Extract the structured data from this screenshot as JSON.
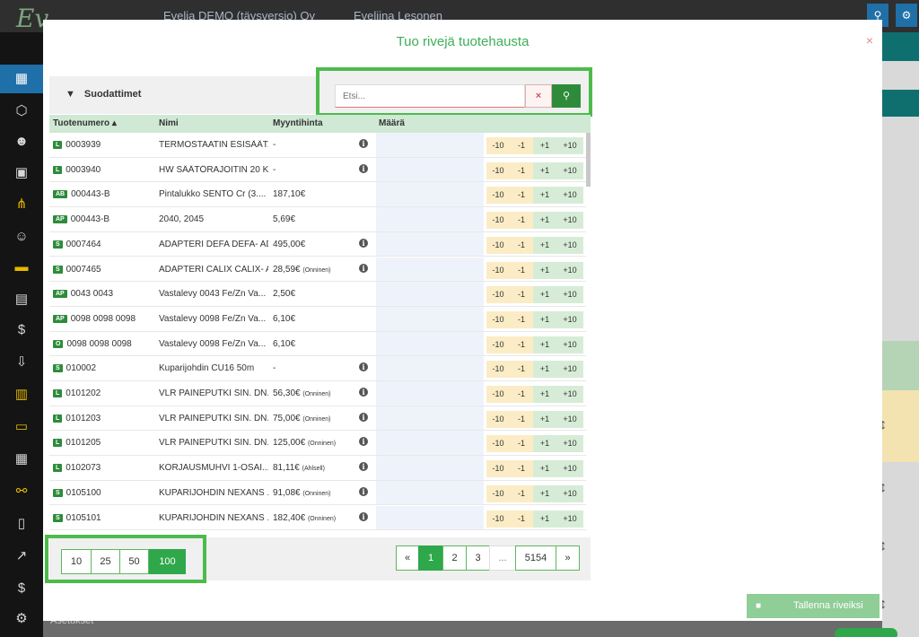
{
  "app": {
    "logo": "Ev",
    "company": "Evelia DEMO (täysversio) Oy",
    "user": "Eveliina Lesonen",
    "sidebar_label": "Asetukset"
  },
  "modal": {
    "title": "Tuo rivejä tuotehausta",
    "close": "×",
    "filter_label": "Suodattimet",
    "search": {
      "placeholder": "Etsi...",
      "clear": "×",
      "go": "⚲"
    },
    "columns": {
      "code": "Tuotenumero ▴",
      "name": "Nimi",
      "price": "Myyntihinta",
      "qty": "Määrä"
    },
    "step_buttons": [
      "-10",
      "-1",
      "+1",
      "+10"
    ],
    "rows": [
      {
        "badge": "L",
        "code": "0003939",
        "name": "TERMOSTAATIN ESISÄÄT...",
        "price": "-",
        "price_note": "",
        "info": true
      },
      {
        "badge": "L",
        "code": "0003940",
        "name": "HW SÄÄTÖRAJOITIN 20 K...",
        "price": "-",
        "price_note": "",
        "info": true
      },
      {
        "badge": "AB",
        "code": "000443-B",
        "name": "Pintalukko SENTO Cr (3....",
        "price": "187,10€",
        "price_note": "",
        "info": false
      },
      {
        "badge": "AP",
        "code": "000443-B",
        "name": "2040, 2045",
        "price": "5,69€",
        "price_note": "",
        "info": false
      },
      {
        "badge": "S",
        "code": "0007464",
        "name": "ADAPTERI DEFA DEFA- AD...",
        "price": "495,00€",
        "price_note": "",
        "info": true
      },
      {
        "badge": "S",
        "code": "0007465",
        "name": "ADAPTERI CALIX CALIX- AD...",
        "price": "28,59€",
        "price_note": "(Onninen)",
        "info": true
      },
      {
        "badge": "AP",
        "code": "0043 0043",
        "name": "Vastalevy 0043 Fe/Zn Va...",
        "price": "2,50€",
        "price_note": "",
        "info": false
      },
      {
        "badge": "AP",
        "code": "0098 0098 0098",
        "name": "Vastalevy 0098 Fe/Zn Va...",
        "price": "6,10€",
        "price_note": "",
        "info": false
      },
      {
        "badge": "O",
        "code": "0098 0098 0098",
        "name": "Vastalevy 0098 Fe/Zn Va...",
        "price": "6,10€",
        "price_note": "",
        "info": false
      },
      {
        "badge": "S",
        "code": "010002",
        "name": "Kuparijohdin CU16 50m",
        "price": "-",
        "price_note": "",
        "info": true
      },
      {
        "badge": "L",
        "code": "0101202",
        "name": "VLR PAINEPUTKI SIN. DN...",
        "price": "56,30€",
        "price_note": "(Onninen)",
        "info": true
      },
      {
        "badge": "L",
        "code": "0101203",
        "name": "VLR PAINEPUTKI SIN. DN...",
        "price": "75,00€",
        "price_note": "(Onninen)",
        "info": true
      },
      {
        "badge": "L",
        "code": "0101205",
        "name": "VLR PAINEPUTKI SIN. DN...",
        "price": "125,00€",
        "price_note": "(Onninen)",
        "info": true
      },
      {
        "badge": "L",
        "code": "0102073",
        "name": "KORJAUSMUHVI 1-OSAI...",
        "price": "81,11€",
        "price_note": "(Ahlsell)",
        "info": true
      },
      {
        "badge": "S",
        "code": "0105100",
        "name": "KUPARIJOHDIN NEXANS ...",
        "price": "91,08€",
        "price_note": "(Onninen)",
        "info": true
      },
      {
        "badge": "S",
        "code": "0105101",
        "name": "KUPARIJOHDIN NEXANS ...",
        "price": "182,40€",
        "price_note": "(Onninen)",
        "info": true
      }
    ],
    "page_sizes": [
      "10",
      "25",
      "50",
      "100"
    ],
    "page_size_selected": "100",
    "pagination": {
      "prev": "«",
      "pages": [
        "1",
        "2",
        "3"
      ],
      "ellipsis": "...",
      "last": "5154",
      "next": "»",
      "current": "1"
    },
    "save_button": "Tallenna riveiksi"
  },
  "colors": {
    "accent": "#2ea84a",
    "highlight": "#4cbb4c",
    "header_bg": "#cfe9d4"
  }
}
